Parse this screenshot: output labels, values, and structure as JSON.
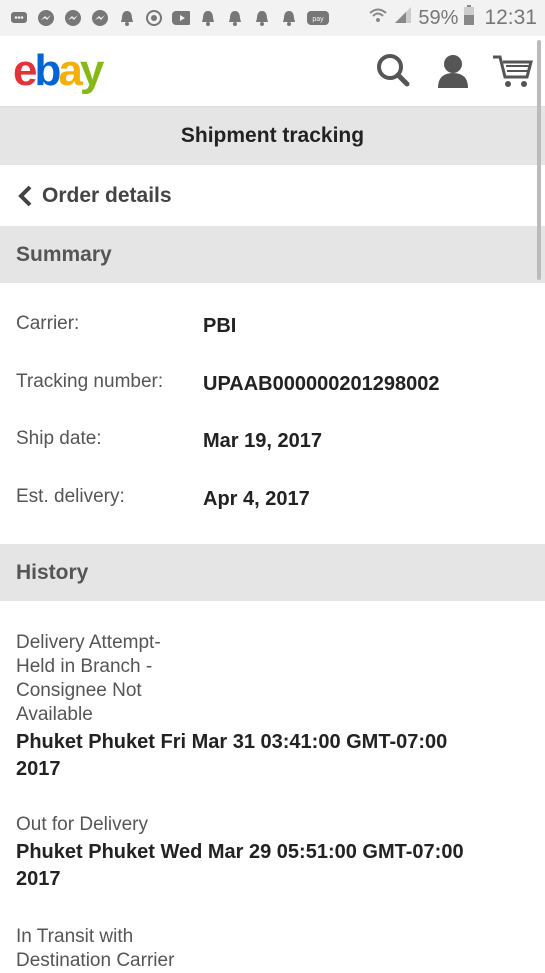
{
  "status_bar": {
    "battery": "59%",
    "time": "12:31"
  },
  "header": {
    "logo": {
      "e": "e",
      "b": "b",
      "a": "a",
      "y": "y"
    }
  },
  "page": {
    "title": "Shipment tracking",
    "back_label": "Order details"
  },
  "summary": {
    "heading": "Summary",
    "rows": [
      {
        "label": "Carrier:",
        "value": "PBI"
      },
      {
        "label": "Tracking number:",
        "value": "UPAAB000000201298002"
      },
      {
        "label": "Ship date:",
        "value": "Mar 19, 2017"
      },
      {
        "label": "Est. delivery:",
        "value": "Apr 4, 2017"
      }
    ]
  },
  "history": {
    "heading": "History",
    "events": [
      {
        "status": "Delivery Attempt-\nHeld in Branch -\nConsignee Not\nAvailable",
        "location_time": "Phuket Phuket  Fri Mar 31 03:41:00 GMT-07:00\n2017"
      },
      {
        "status": "Out for Delivery",
        "location_time": "Phuket Phuket  Wed Mar 29 05:51:00 GMT-07:00\n2017"
      },
      {
        "status": "In Transit with\nDestination Carrier",
        "location_time": ""
      }
    ]
  },
  "colors": {
    "header_bg": "#e5e5e5",
    "ebay_red": "#e53238",
    "ebay_blue": "#0064d2",
    "ebay_yellow": "#f5af02",
    "ebay_green": "#86b817"
  },
  "icons": [
    "search-icon",
    "account-icon",
    "cart-icon",
    "chevron-left-icon"
  ]
}
